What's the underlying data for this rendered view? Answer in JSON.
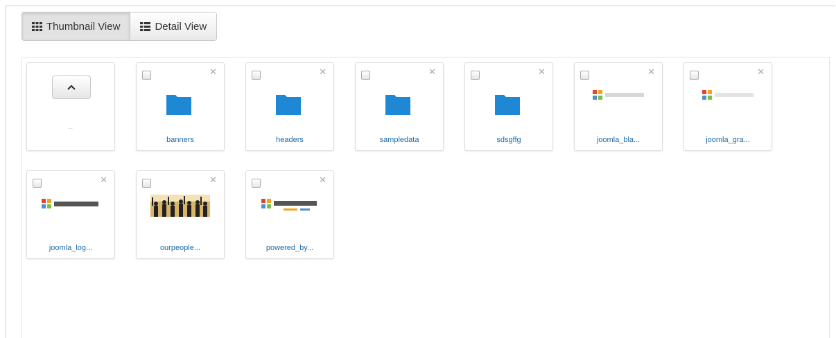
{
  "toolbar": {
    "thumbnail_view_label": "Thumbnail View",
    "detail_view_label": "Detail View",
    "active_view": "thumbnail"
  },
  "navigation": {
    "up_label": ".."
  },
  "colors": {
    "folder": "#1e88d4",
    "label": "#1a6aa8",
    "accent_red": "#e0462a"
  },
  "items": [
    {
      "type": "folder",
      "name": "banners"
    },
    {
      "type": "folder",
      "name": "headers"
    },
    {
      "type": "folder",
      "name": "sampledata"
    },
    {
      "type": "folder",
      "name": "sdsgffg"
    },
    {
      "type": "image",
      "name": "joomla_bla...",
      "image": "joomla-logo"
    },
    {
      "type": "image",
      "name": "joomla_gra...",
      "image": "joomla-logo"
    },
    {
      "type": "image",
      "name": "joomla_log...",
      "image": "joomla-logo"
    },
    {
      "type": "image",
      "name": "ourpeople...",
      "image": "people-silhouettes"
    },
    {
      "type": "image",
      "name": "powered_by...",
      "image": "joomla-logo"
    }
  ]
}
